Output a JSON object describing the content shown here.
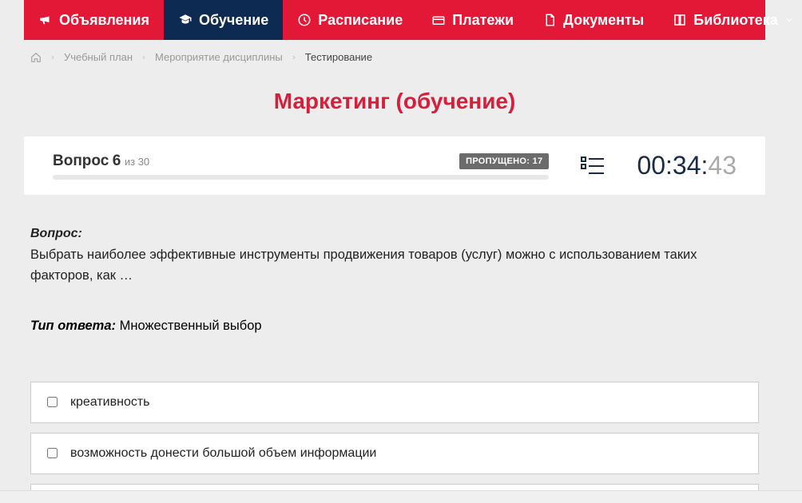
{
  "nav": {
    "items": [
      {
        "label": "Объявления",
        "icon": "megaphone"
      },
      {
        "label": "Обучение",
        "icon": "graduation",
        "active": true
      },
      {
        "label": "Расписание",
        "icon": "clock"
      },
      {
        "label": "Платежи",
        "icon": "payment"
      },
      {
        "label": "Документы",
        "icon": "document"
      },
      {
        "label": "Библиотека",
        "icon": "book",
        "dropdown": true
      }
    ]
  },
  "breadcrumb": {
    "items": [
      "Учебный план",
      "Мероприятие дисциплины"
    ],
    "current": "Тестирование"
  },
  "page_title": "Маркетинг (обучение)",
  "quiz": {
    "question_label": "Вопрос",
    "question_number": "6",
    "of_label": "из",
    "total": "30",
    "skipped_label": "ПРОПУЩЕНО:",
    "skipped_count": "17",
    "progress_percent": 0
  },
  "timer": {
    "mm": "00",
    "ss": "34",
    "ms": "43"
  },
  "question": {
    "label": "Вопрос:",
    "text": "Выбрать наиболее эффективные инструменты продвижения товаров (услуг) можно с использованием таких факторов, как …"
  },
  "answer_type": {
    "label": "Тип ответа:",
    "value": "Множественный выбор"
  },
  "answers": [
    {
      "text": "креативность",
      "checked": false
    },
    {
      "text": "возможность донести большой объем информации",
      "checked": false
    }
  ]
}
